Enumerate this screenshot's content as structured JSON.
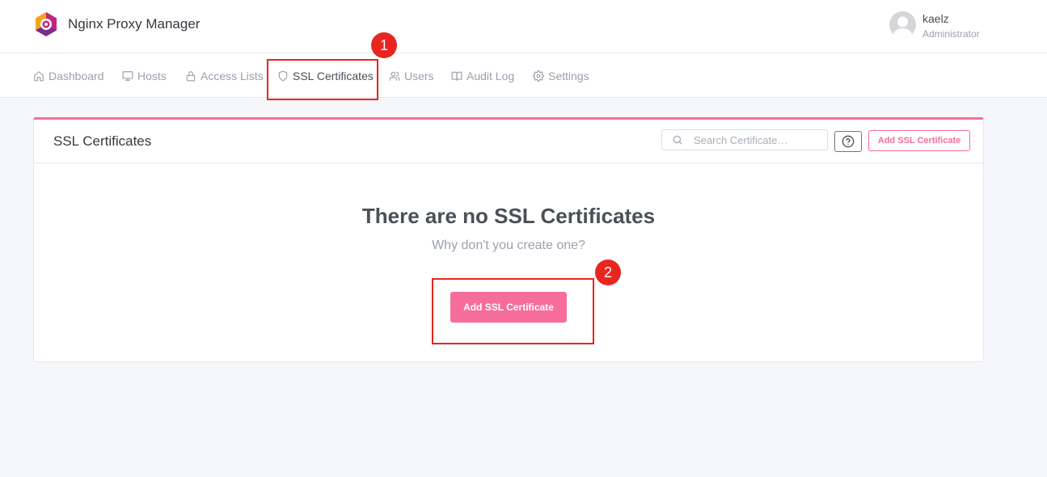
{
  "brand": {
    "name": "Nginx Proxy Manager",
    "logo_icon": "nginx-proxy-manager-logo"
  },
  "user": {
    "name": "kaelz",
    "role": "Administrator"
  },
  "nav": {
    "items": [
      {
        "label": "Dashboard",
        "icon": "home-icon"
      },
      {
        "label": "Hosts",
        "icon": "monitor-icon"
      },
      {
        "label": "Access Lists",
        "icon": "lock-icon"
      },
      {
        "label": "SSL Certificates",
        "icon": "shield-icon",
        "active": true
      },
      {
        "label": "Users",
        "icon": "users-icon"
      },
      {
        "label": "Audit Log",
        "icon": "book-icon"
      },
      {
        "label": "Settings",
        "icon": "gear-icon"
      }
    ]
  },
  "card": {
    "title": "SSL Certificates",
    "search_placeholder": "Search Certificate…",
    "add_button_label": "Add SSL Certificate"
  },
  "empty": {
    "title": "There are no SSL Certificates",
    "subtitle": "Why don't you create one?",
    "button_label": "Add SSL Certificate"
  },
  "annotations": {
    "badge1": "1",
    "badge2": "2"
  },
  "colors": {
    "accent": "#f66d9b",
    "annotation": "#e8251f"
  }
}
